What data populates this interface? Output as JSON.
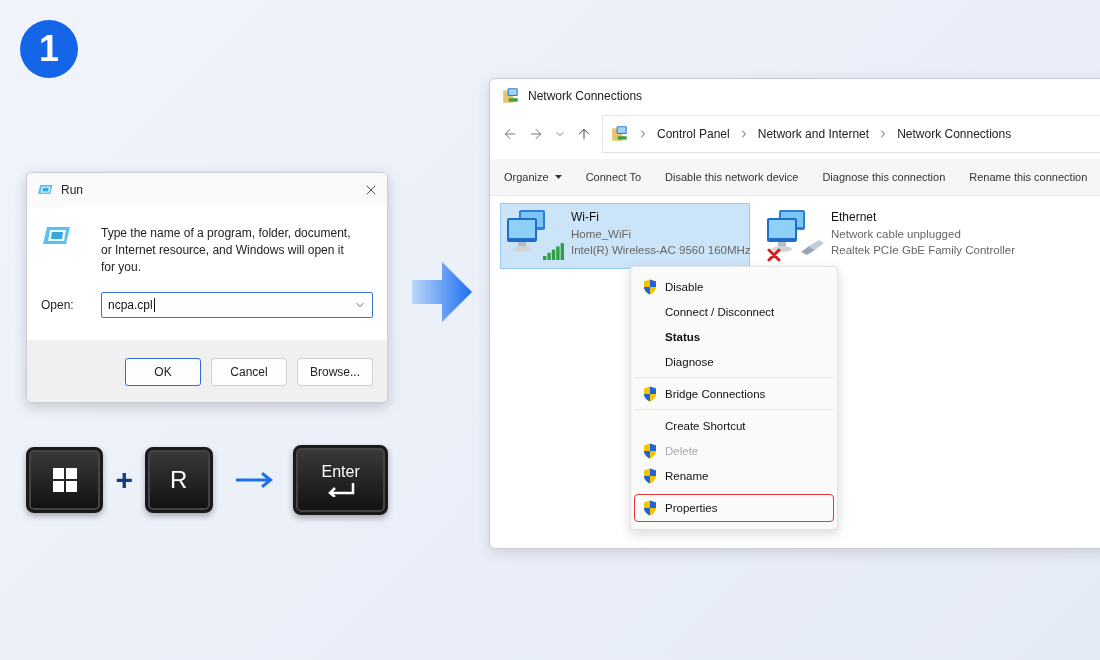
{
  "step": {
    "number": "1"
  },
  "run_dialog": {
    "title": "Run",
    "description": "Type the name of a program, folder, document, or Internet resource, and Windows will open it for you.",
    "open_label": "Open:",
    "open_value": "ncpa.cpl",
    "buttons": [
      {
        "label": "OK",
        "selected": true
      },
      {
        "label": "Cancel",
        "selected": false
      },
      {
        "label": "Browse...",
        "selected": false
      }
    ]
  },
  "shortcut": {
    "keys": [
      {
        "kind": "windows"
      },
      {
        "kind": "letter",
        "label": "R"
      }
    ],
    "joiner": "+",
    "enter_key": {
      "label": "Enter"
    }
  },
  "explorer": {
    "title": "Network Connections",
    "breadcrumb": [
      "Control Panel",
      "Network and Internet",
      "Network Connections"
    ],
    "toolbar": [
      {
        "label": "Organize",
        "dropdown": true
      },
      {
        "label": "Connect To",
        "dropdown": false
      },
      {
        "label": "Disable this network device",
        "dropdown": false
      },
      {
        "label": "Diagnose this connection",
        "dropdown": false
      },
      {
        "label": "Rename this connection",
        "dropdown": false
      }
    ],
    "connections": [
      {
        "kind": "wifi",
        "name": "Wi-Fi",
        "status": "Home_WiFi",
        "adapter": "Intel(R) Wireless-AC 9560 160MHz",
        "selected": true
      },
      {
        "kind": "ethernet",
        "name": "Ethernet",
        "status": "Network cable unplugged",
        "adapter": "Realtek PCIe GbE Family Controller",
        "selected": false
      }
    ],
    "context_menu": [
      [
        {
          "label": "Disable",
          "shield": true,
          "bold": false,
          "disabled": false,
          "highlighted": false
        },
        {
          "label": "Connect / Disconnect",
          "shield": false,
          "bold": false,
          "disabled": false,
          "highlighted": false
        },
        {
          "label": "Status",
          "shield": false,
          "bold": true,
          "disabled": false,
          "highlighted": false
        },
        {
          "label": "Diagnose",
          "shield": false,
          "bold": false,
          "disabled": false,
          "highlighted": false
        }
      ],
      [
        {
          "label": "Bridge Connections",
          "shield": true,
          "bold": false,
          "disabled": false,
          "highlighted": false
        }
      ],
      [
        {
          "label": "Create Shortcut",
          "shield": false,
          "bold": false,
          "disabled": false,
          "highlighted": false
        },
        {
          "label": "Delete",
          "shield": true,
          "bold": false,
          "disabled": true,
          "highlighted": false
        },
        {
          "label": "Rename",
          "shield": true,
          "bold": false,
          "disabled": false,
          "highlighted": false
        },
        {
          "label": "Properties",
          "shield": true,
          "bold": false,
          "disabled": false,
          "highlighted": true
        }
      ]
    ]
  }
}
